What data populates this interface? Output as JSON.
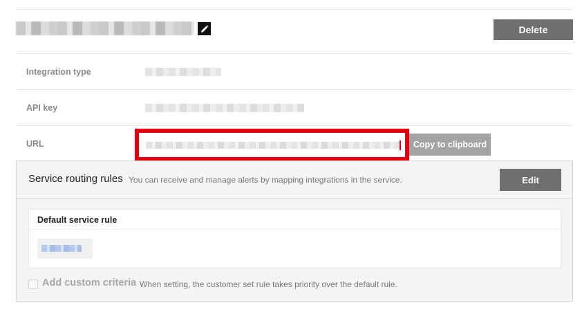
{
  "header": {
    "integration_name": "",
    "edit_icon": "pencil-icon",
    "delete_label": "Delete"
  },
  "details": {
    "integration_type_label": "Integration type",
    "integration_type_value": "",
    "api_key_label": "API key",
    "api_key_value": "",
    "url_label": "URL",
    "url_value": "",
    "copy_label": "Copy to clipboard"
  },
  "routing": {
    "title": "Service routing rules",
    "description": "You can receive and manage alerts by mapping integrations in the service.",
    "edit_label": "Edit",
    "default_rule_title": "Default service rule",
    "default_rule_value": "",
    "add_criteria_label": "Add custom criteria",
    "add_criteria_description": "When setting, the customer set rule takes priority over the default rule.",
    "add_criteria_checked": false
  },
  "colors": {
    "highlight_border": "#e0000f",
    "primary_button": "#6f6f6f",
    "secondary_button": "#a3a3a3"
  }
}
